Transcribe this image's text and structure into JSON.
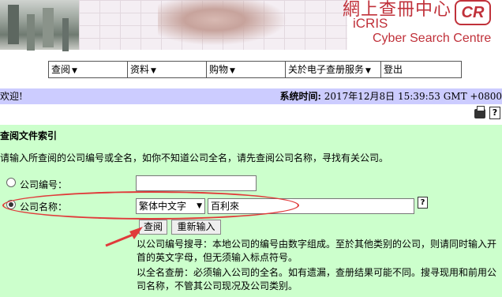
{
  "banner": {
    "title_cn": "網上查冊中心",
    "brand_short": "iCRIS",
    "brand_full": "Cyber Search Centre",
    "logo_text": "CR"
  },
  "menu": {
    "items": [
      {
        "label": "查阅",
        "icon": "chevron-down-icon"
      },
      {
        "label": "资料",
        "icon": "chevron-down-icon"
      },
      {
        "label": "购物",
        "icon": "chevron-down-icon"
      },
      {
        "label": "关於电子查册服务",
        "icon": "chevron-down-icon"
      },
      {
        "label": "登出"
      }
    ]
  },
  "welcome": {
    "greeting": "欢迎!",
    "system_time_label": "系统时间:",
    "system_time_value": "2017年12月8日 15:39:53 GMT +0800"
  },
  "tools": {
    "print_icon": "print-icon",
    "help_icon": "help-icon"
  },
  "form": {
    "heading": "查阅文件索引",
    "intro": "请输入所查阅的公司编号或全名，如你不知道公司全名，请先查阅公司名称，寻找有关公司。",
    "company_no_label": "公司编号：",
    "company_no_value": "",
    "company_name_label": "公司名称：",
    "language_selected": "繁体中文字",
    "company_name_value": "百利來",
    "search_button": "查阅",
    "reset_button": "重新输入",
    "note1": "以公司编号搜寻：本地公司的编号由数字组成。至於其他类别的公司，则请同时输入开首的英文字母，但无须输入标点符号。",
    "note2": "以全名查册：必须输入公司的全名。如有遗漏，查册结果可能不同。搜寻现用和前用公司名称，不管其公司现况及公司类别。",
    "selected_option": "company-name"
  },
  "colors": {
    "welcome_bg": "#ccccff",
    "panel_bg": "#ccffcc",
    "brand_red": "#c0313a",
    "annotation_red": "#e03a3a"
  }
}
